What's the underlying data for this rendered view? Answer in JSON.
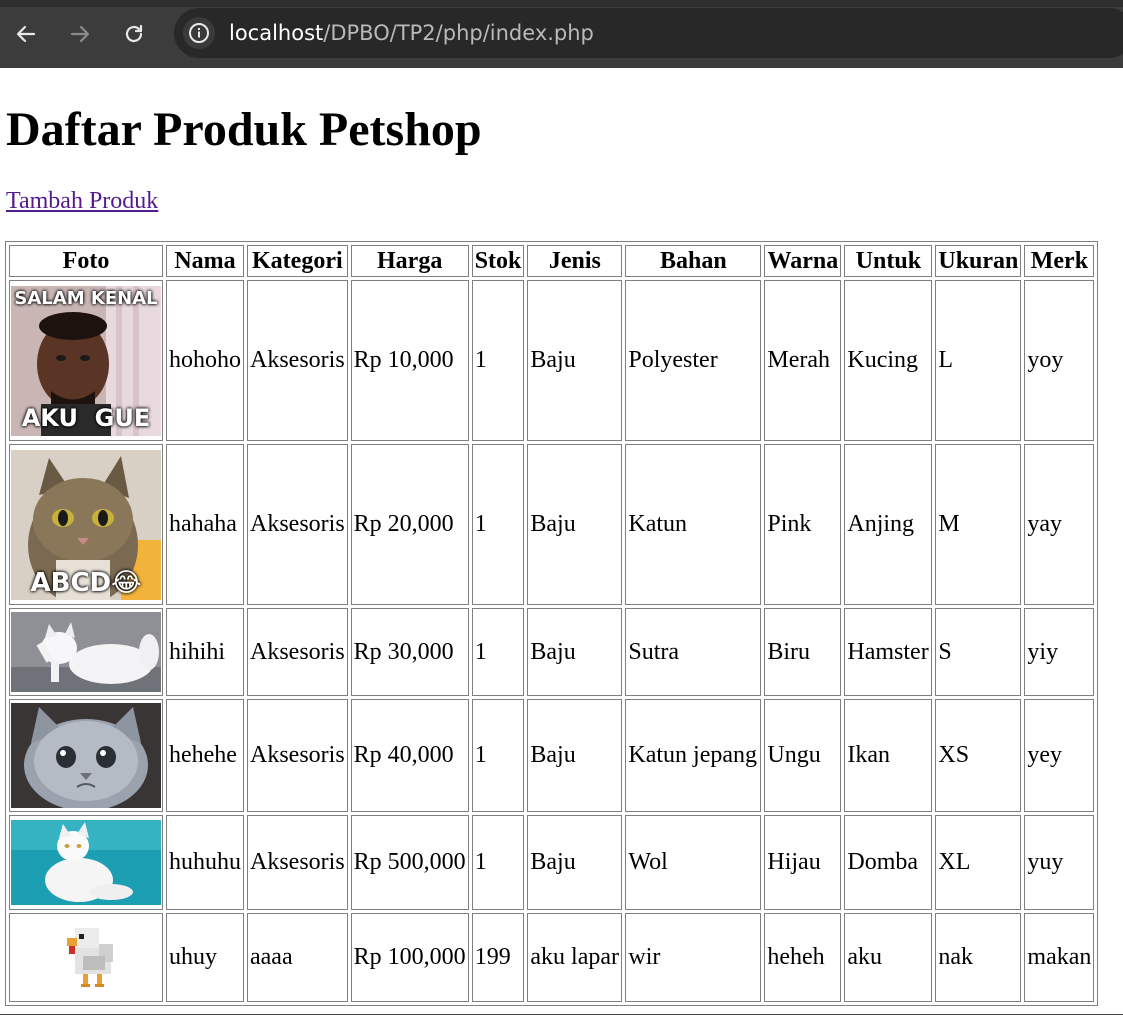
{
  "browser": {
    "url_host": "localhost",
    "url_path": "/DPBO/TP2/php/index.php"
  },
  "page": {
    "title": "Daftar Produk Petshop",
    "add_link": "Tambah Produk"
  },
  "table": {
    "headers": [
      "Foto",
      "Nama",
      "Kategori",
      "Harga",
      "Stok",
      "Jenis",
      "Bahan",
      "Warna",
      "Untuk",
      "Ukuran",
      "Merk"
    ],
    "rows": [
      {
        "photo": "meme-man-salam-kenal",
        "photo_top": "SALAM KENAL",
        "photo_bottom": "AKU  GUE",
        "nama": "hohoho",
        "kategori": "Aksesoris",
        "harga": "Rp 10,000",
        "stok": "1",
        "jenis": "Baju",
        "bahan": "Polyester",
        "warna": "Merah",
        "untuk": "Kucing",
        "ukuran": "L",
        "merk": "yoy"
      },
      {
        "photo": "cat-meme-abcd",
        "photo_bottom": "ABCD😂",
        "nama": "hahaha",
        "kategori": "Aksesoris",
        "harga": "Rp 20,000",
        "stok": "1",
        "jenis": "Baju",
        "bahan": "Katun",
        "warna": "Pink",
        "untuk": "Anjing",
        "ukuran": "M",
        "merk": "yay"
      },
      {
        "photo": "white-persian-cat",
        "nama": "hihihi",
        "kategori": "Aksesoris",
        "harga": "Rp 30,000",
        "stok": "1",
        "jenis": "Baju",
        "bahan": "Sutra",
        "warna": "Biru",
        "untuk": "Hamster",
        "ukuran": "S",
        "merk": "yiy"
      },
      {
        "photo": "sad-grey-kitten",
        "nama": "hehehe",
        "kategori": "Aksesoris",
        "harga": "Rp 40,000",
        "stok": "1",
        "jenis": "Baju",
        "bahan": "Katun jepang",
        "warna": "Ungu",
        "untuk": "Ikan",
        "ukuran": "XS",
        "merk": "yey"
      },
      {
        "photo": "white-cat-teal-background",
        "nama": "huhuhu",
        "kategori": "Aksesoris",
        "harga": "Rp 500,000",
        "stok": "1",
        "jenis": "Baju",
        "bahan": "Wol",
        "warna": "Hijau",
        "untuk": "Domba",
        "ukuran": "XL",
        "merk": "yuy"
      },
      {
        "photo": "pixel-chicken",
        "nama": "uhuy",
        "kategori": "aaaa",
        "harga": "Rp 100,000",
        "stok": "199",
        "jenis": "aku lapar",
        "bahan": "wir",
        "warna": "heheh",
        "untuk": "aku",
        "ukuran": "nak",
        "merk": "makan"
      }
    ]
  },
  "colors": {
    "chrome_bg": "#3c3c3c",
    "omnibox_bg": "#282828",
    "visited_link": "#551a8b",
    "cell_border": "#808080"
  }
}
